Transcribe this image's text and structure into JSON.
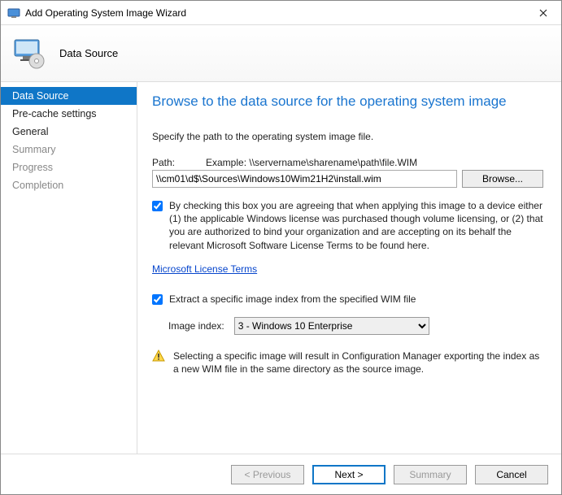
{
  "window": {
    "title": "Add Operating System Image Wizard"
  },
  "header": {
    "title": "Data Source"
  },
  "sidebar": {
    "items": [
      {
        "label": "Data Source",
        "active": true,
        "dim": false
      },
      {
        "label": "Pre-cache settings",
        "active": false,
        "dim": false
      },
      {
        "label": "General",
        "active": false,
        "dim": false
      },
      {
        "label": "Summary",
        "active": false,
        "dim": true
      },
      {
        "label": "Progress",
        "active": false,
        "dim": true
      },
      {
        "label": "Completion",
        "active": false,
        "dim": true
      }
    ]
  },
  "main": {
    "heading": "Browse to the data source for the operating system image",
    "instruction": "Specify the path to the operating system image file.",
    "path_label": "Path:",
    "example": "Example: \\\\servername\\sharename\\path\\file.WIM",
    "path_value": "\\\\cm01\\d$\\Sources\\Windows10Wim21H2\\install.wim",
    "browse_label": "Browse...",
    "license_checkbox": "By checking this box you are agreeing that when applying this image to a device either (1) the applicable Windows license was purchased though volume licensing, or (2) that you are authorized to bind your organization and are accepting on its behalf the relevant Microsoft Software License Terms to be found here.",
    "license_link": "Microsoft License Terms",
    "extract_checkbox": "Extract a specific image index from the specified WIM file",
    "index_label": "Image index:",
    "index_selected": "3 - Windows 10 Enterprise",
    "warning_text": "Selecting a specific image will result in Configuration Manager exporting the index as a new WIM file in the same directory as the source image."
  },
  "footer": {
    "previous": "< Previous",
    "next": "Next >",
    "summary": "Summary",
    "cancel": "Cancel"
  }
}
